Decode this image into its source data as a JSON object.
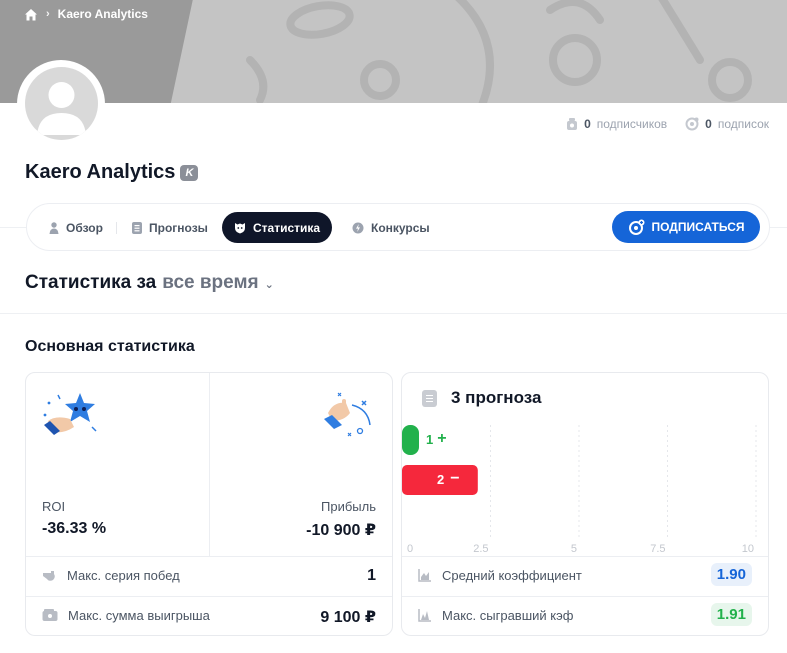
{
  "breadcrumb": {
    "current": "Kaero Analytics"
  },
  "profile": {
    "name": "Kaero Analytics",
    "badge": "K"
  },
  "subs": {
    "subscribers_count": "0",
    "subscribers_label": "подписчиков",
    "subscriptions_count": "0",
    "subscriptions_label": "подписок"
  },
  "tabs": [
    {
      "label": "Обзор",
      "icon": "person-icon",
      "active": false
    },
    {
      "label": "Прогнозы",
      "icon": "list-icon",
      "active": false
    },
    {
      "label": "Статистика",
      "icon": "shield-cat-icon",
      "active": true
    },
    {
      "label": "Конкурсы",
      "icon": "contest-icon",
      "active": false
    }
  ],
  "subscribe_label": "ПОДПИСАТЬСЯ",
  "period": {
    "prefix": "Статистика за",
    "value": "все время"
  },
  "main_stats": {
    "title": "Основная статистика",
    "roi_label": "ROI",
    "roi_value": "-36.33 %",
    "profit_label": "Прибыль",
    "profit_value": "-10 900 ₽",
    "win_streak_label": "Макс. серия побед",
    "win_streak_value": "1",
    "max_win_label": "Макс. сумма выигрыша",
    "max_win_value": "9 100 ₽"
  },
  "forecasts": {
    "title": "3 прогноза",
    "wins_label": "1",
    "losses_label": "2",
    "avg_odds_label": "Средний коэффициент",
    "avg_odds_value": "1.90",
    "max_won_odds_label": "Макс. сыгравший кэф",
    "max_won_odds_value": "1.91"
  },
  "chart_data": {
    "type": "bar",
    "orientation": "horizontal",
    "categories": [
      "+",
      "−"
    ],
    "values": [
      1,
      2
    ],
    "x_ticks": [
      "0",
      "2.5",
      "5",
      "7.5",
      "10"
    ],
    "xlim": [
      0,
      10
    ],
    "colors": [
      "#22b14c",
      "#f5283c"
    ],
    "grid": true
  },
  "colors": {
    "accent": "#1565d8",
    "active_tab": "#0f1629",
    "win": "#22b14c",
    "loss": "#f5283c"
  }
}
